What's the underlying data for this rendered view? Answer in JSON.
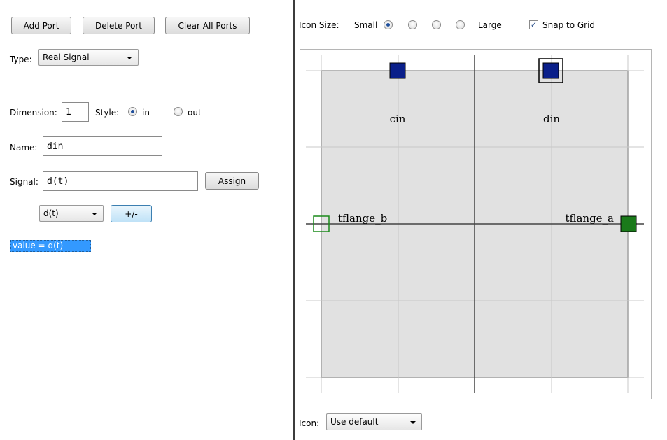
{
  "toolbar": {
    "add_port": "Add Port",
    "delete_port": "Delete Port",
    "clear_all_ports": "Clear All Ports"
  },
  "port_form": {
    "type_label": "Type:",
    "type_value": "Real Signal",
    "dimension_label": "Dimension:",
    "dimension_value": "1",
    "style_label": "Style:",
    "style_in": "in",
    "style_out": "out",
    "style_selected": "in",
    "name_label": "Name:",
    "name_value": "din",
    "signal_label": "Signal:",
    "signal_value": "d(t)",
    "assign_button": "Assign",
    "signal_dropdown": "d(t)",
    "sign_button": "+/-",
    "value_list": [
      "value = d(t)"
    ]
  },
  "icon_settings": {
    "icon_size_label": "Icon Size:",
    "small_label": "Small",
    "large_label": "Large",
    "size_selected_index": 0,
    "size_option_count": 4,
    "snap_to_grid_label": "Snap to Grid",
    "snap_to_grid_checked": true,
    "icon_label": "Icon:",
    "icon_value": "Use default"
  },
  "canvas": {
    "ports": [
      {
        "name": "cin",
        "side": "top",
        "color": "#0a1f8a",
        "filled": true,
        "selected": false
      },
      {
        "name": "din",
        "side": "top",
        "color": "#0a1f8a",
        "filled": true,
        "selected": true
      },
      {
        "name": "tflange_b",
        "side": "left",
        "color": "#1a8a1a",
        "filled": false,
        "selected": false
      },
      {
        "name": "tflange_a",
        "side": "right",
        "color": "#1a7a1a",
        "filled": true,
        "selected": false
      }
    ],
    "labels": {
      "cin": "cin",
      "din": "din",
      "tflange_b": "tflange_b",
      "tflange_a": "tflange_a"
    },
    "colors": {
      "icon_fill": "#e1e1e1",
      "grid_line": "#c8c8c8",
      "axis_line": "#444444",
      "port_blue": "#0a1f8a",
      "port_green": "#1a7a1a"
    }
  },
  "colors": {
    "selection_blue": "#3399ff",
    "divider": "#3c3c3c"
  }
}
